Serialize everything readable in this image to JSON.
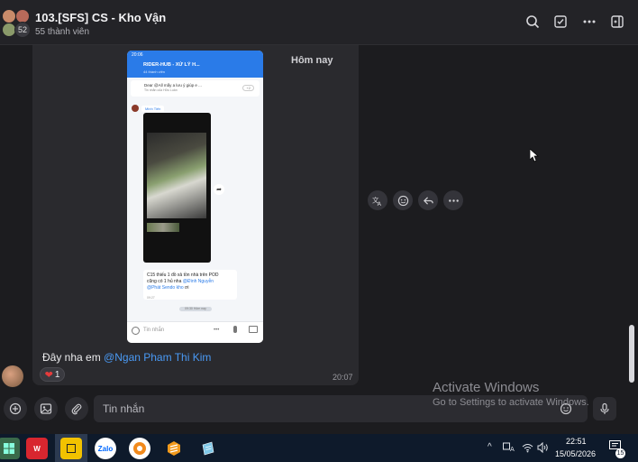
{
  "header": {
    "title": "103.[SFS] CS - Kho Vận",
    "members": "55 thành viên",
    "avatar_count": "52"
  },
  "chat": {
    "date_label": "Hôm nay",
    "message": {
      "text_prefix": "Đây nha em ",
      "mention": "@Ngan Pham Thi Kim",
      "reaction_count": "1",
      "time": "20:07"
    },
    "embedded_screenshot": {
      "status": "20:06",
      "title": "RIDER-HUB - XỬ LÝ H...",
      "subtitle": "44 thành viên",
      "pinned": "Dear @All mấy a lưu ý giúp e ...",
      "pinned_sub": "Tin nhắn của Hữu Luân",
      "pinned_more": "+2",
      "sender": "Minh Tiến",
      "inner_msg_1": "C15 thiếu 1 đồ xả tồn nhà trên POD",
      "inner_msg_2": "cũng có 1 hủ nha ",
      "inner_mention_1": "@Đình Nguyễn",
      "inner_mention_2": "@Phát Sendo kho",
      "inner_msg_3": " ơi",
      "inner_time": "09:27",
      "separator": "09:30 Hôm nay",
      "input_placeholder": "Tin nhắn"
    }
  },
  "composer": {
    "placeholder": "Tin nhắn"
  },
  "watermark": {
    "line1": "Activate Windows",
    "line2": "Go to Settings to activate Windows."
  },
  "taskbar": {
    "apps": [
      "windows",
      "wps",
      "sticky-notes",
      "zalo",
      "chrome-alt",
      "sublime",
      "notepad"
    ],
    "app_labels": {
      "wps": "W",
      "zalo": "Zalo"
    },
    "time": "22:51",
    "date": "15/05/2026",
    "notifications": "15"
  }
}
